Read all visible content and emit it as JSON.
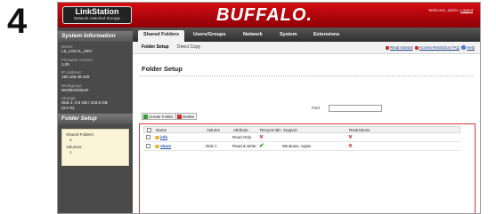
{
  "step": "4",
  "header": {
    "logo_main": "LinkStation",
    "logo_sub": "Network Attached Storage",
    "brand": "BUFFALO.",
    "welcome_prefix": "Welcome, admin",
    "logout": "Logout"
  },
  "sidebar": {
    "title": "System Information",
    "info": [
      {
        "label": "Name:",
        "value": "LS_LOCAL_DEV"
      },
      {
        "label": "Firmware version:",
        "value": "1.00"
      },
      {
        "label": "IP Address:",
        "value": "192.168.49.120"
      },
      {
        "label": "Workgroup:",
        "value": "WORKGROUP"
      },
      {
        "label": "Storage:",
        "value": "Disk 1: 0.6 GB / 218.6 GB",
        "value2": "(0.0 %)"
      }
    ],
    "folder_title": "Folder Setup",
    "folder_box": {
      "shared_label": "Shared Folders:",
      "shared_value": "2",
      "volumes_label": "Volumes:",
      "volumes_value": "1"
    }
  },
  "tabs": [
    "Shared Folders",
    "Users/Groups",
    "Network",
    "System",
    "Extensions"
  ],
  "subtabs": [
    "Folder Setup",
    "Direct Copy"
  ],
  "help_links": {
    "read_manual": "Read manual",
    "access_restriction": "Access Restriction FAQ",
    "help": "Help"
  },
  "page_title": "Folder Setup",
  "buttons": {
    "create": "Create Folder",
    "delete": "Delete"
  },
  "find_label": "Find",
  "table": {
    "headers": [
      "Name",
      "Volume",
      "Attribute",
      "Recycle Bin",
      "Support",
      "Restrictions"
    ],
    "rows": [
      {
        "name": "info",
        "volume": "",
        "attribute": "Read Only",
        "recycle": "x",
        "support": "",
        "restrictions": "x"
      },
      {
        "name": "share",
        "volume": "Disk 1",
        "attribute": "Read & Write",
        "recycle": "check",
        "support": "Windows, Apple",
        "restrictions": "x"
      }
    ]
  },
  "colors": {
    "brand_red": "#c4080e",
    "link_blue": "#1d4eaa",
    "error_red": "#d21f1f",
    "ok_green": "#2e9a2e"
  },
  "icons": {
    "restriction_yes": "red-x-icon",
    "recycle_on": "green-check-icon",
    "folder": "folder-icon"
  }
}
